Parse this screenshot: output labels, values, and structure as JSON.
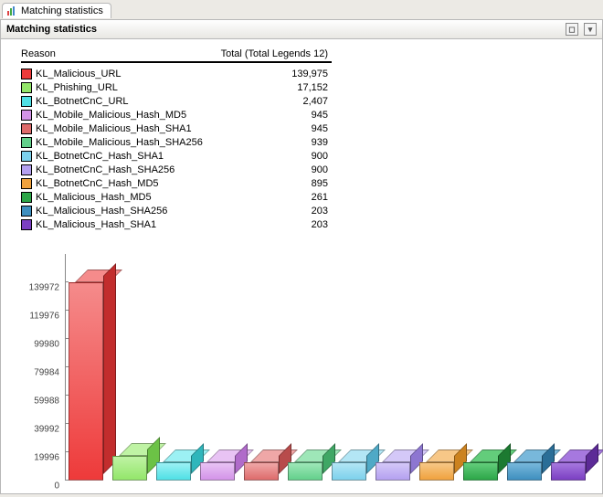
{
  "tab_label": "Matching statistics",
  "subheader_title": "Matching statistics",
  "legend_header": {
    "reason": "Reason",
    "total": "Total (Total Legends 12)"
  },
  "items": [
    {
      "name": "KL_Malicious_URL",
      "value": 139975,
      "display": "139,975",
      "fill": "#ee3a3a",
      "light": "#f58b8b",
      "dark": "#c22d2d"
    },
    {
      "name": "KL_Phishing_URL",
      "value": 17152,
      "display": "17,152",
      "fill": "#93e66a",
      "light": "#bff3a4",
      "dark": "#6cc246"
    },
    {
      "name": "KL_BotnetCnC_URL",
      "value": 2407,
      "display": "2,407",
      "fill": "#4fe0e5",
      "light": "#9cf1f4",
      "dark": "#2fb6bb"
    },
    {
      "name": "KL_Mobile_Malicious_Hash_MD5",
      "value": 945,
      "display": "945",
      "fill": "#d393e8",
      "light": "#e8c3f4",
      "dark": "#b06bca"
    },
    {
      "name": "KL_Mobile_Malicious_Hash_SHA1",
      "value": 945,
      "display": "945",
      "fill": "#de6b6b",
      "light": "#efa7a7",
      "dark": "#b84b4b"
    },
    {
      "name": "KL_Mobile_Malicious_Hash_SHA256",
      "value": 939,
      "display": "939",
      "fill": "#63d08b",
      "light": "#9ee7b8",
      "dark": "#3fa765"
    },
    {
      "name": "KL_BotnetCnC_Hash_SHA1",
      "value": 900,
      "display": "900",
      "fill": "#7cd1ec",
      "light": "#b3e6f5",
      "dark": "#4fa9c6"
    },
    {
      "name": "KL_BotnetCnC_Hash_SHA256",
      "value": 900,
      "display": "900",
      "fill": "#b4a0f0",
      "light": "#d4c8f8",
      "dark": "#8d76d1"
    },
    {
      "name": "KL_BotnetCnC_Hash_MD5",
      "value": 895,
      "display": "895",
      "fill": "#f0a23e",
      "light": "#f7c787",
      "dark": "#cc821f"
    },
    {
      "name": "KL_Malicious_Hash_MD5",
      "value": 261,
      "display": "261",
      "fill": "#2ca648",
      "light": "#63cd7b",
      "dark": "#1c7a31"
    },
    {
      "name": "KL_Malicious_Hash_SHA256",
      "value": 203,
      "display": "203",
      "fill": "#3e8fbf",
      "light": "#78b8db",
      "dark": "#2a6e97"
    },
    {
      "name": "KL_Malicious_Hash_SHA1",
      "value": 203,
      "display": "203",
      "fill": "#7b3fc2",
      "light": "#a678df",
      "dark": "#5c2a97"
    }
  ],
  "yticks": [
    0,
    19996,
    39992,
    59988,
    79984,
    99980,
    119976,
    139972
  ],
  "chart_data": {
    "type": "bar",
    "title": "Matching statistics",
    "xlabel": "",
    "ylabel": "",
    "ylim": [
      0,
      160000
    ],
    "categories": [
      "KL_Malicious_URL",
      "KL_Phishing_URL",
      "KL_BotnetCnC_URL",
      "KL_Mobile_Malicious_Hash_MD5",
      "KL_Mobile_Malicious_Hash_SHA1",
      "KL_Mobile_Malicious_Hash_SHA256",
      "KL_BotnetCnC_Hash_SHA1",
      "KL_BotnetCnC_Hash_SHA256",
      "KL_BotnetCnC_Hash_MD5",
      "KL_Malicious_Hash_MD5",
      "KL_Malicious_Hash_SHA256",
      "KL_Malicious_Hash_SHA1"
    ],
    "values": [
      139975,
      17152,
      2407,
      945,
      945,
      939,
      900,
      900,
      895,
      261,
      203,
      203
    ]
  }
}
